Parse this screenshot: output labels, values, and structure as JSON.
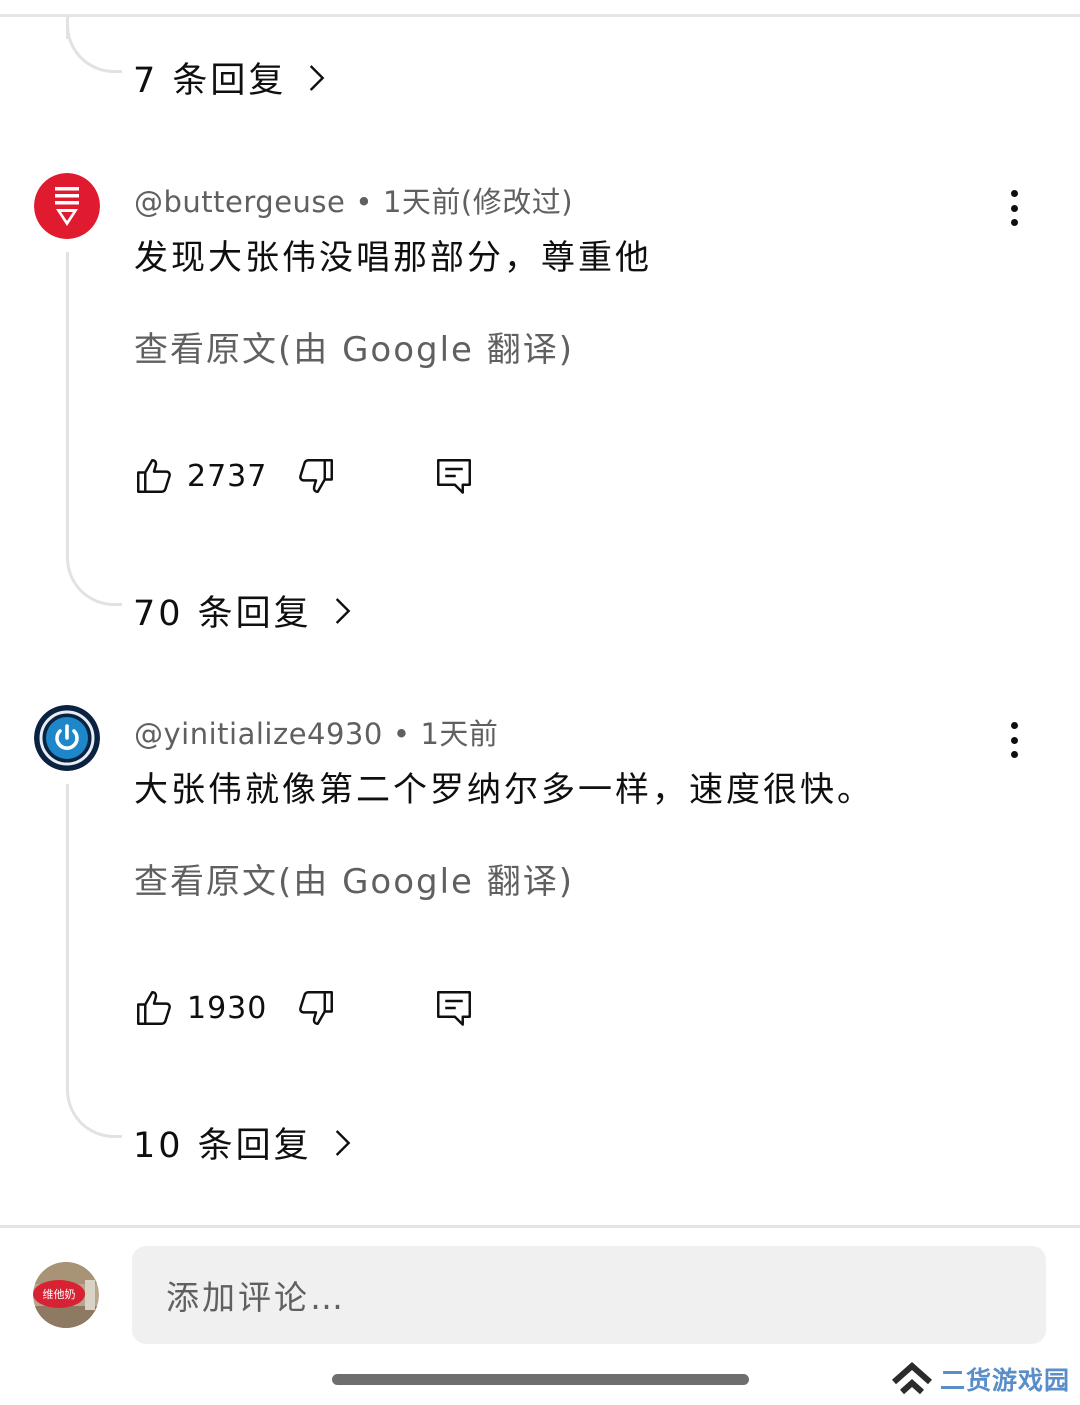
{
  "top_thread": {
    "replies_label": "7 条回复"
  },
  "comments": [
    {
      "author": "@buttergeuse",
      "separator": "•",
      "time": "1天前(修改过)",
      "text": "发现大张伟没唱那部分，尊重他",
      "translate_label": "查看原文(由 Google 翻译)",
      "likes": "2737",
      "replies_label": "70 条回复",
      "avatar_color": "#e01b2f"
    },
    {
      "author": "@yinitialize4930",
      "separator": "•",
      "time": "1天前",
      "text": "大张伟就像第二个罗纳尔多一样，速度很快。",
      "translate_label": "查看原文(由 Google 翻译)",
      "likes": "1930",
      "replies_label": "10 条回复",
      "avatar_color": "#0d2a4a"
    }
  ],
  "composer": {
    "placeholder": "添加评论…",
    "avatar_text": "维他奶"
  },
  "watermark": {
    "text": "二货游戏园"
  },
  "colors": {
    "secondary_text": "#606060",
    "divider": "#e5e5e5",
    "input_bg": "#f0f0f0",
    "watermark": "#5a8ec9"
  }
}
